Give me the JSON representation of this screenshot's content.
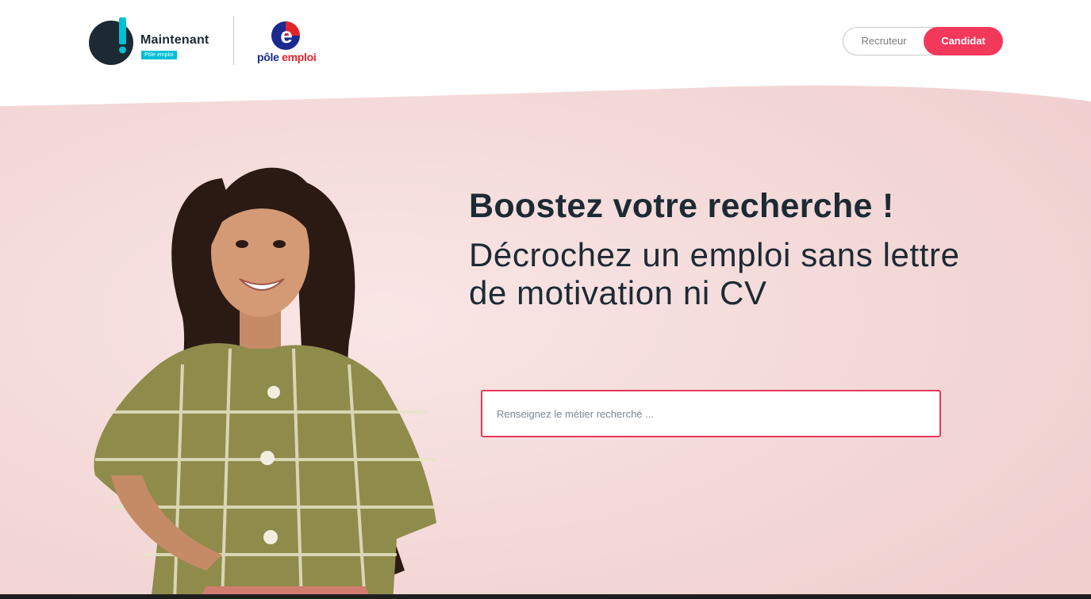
{
  "header": {
    "brand_name": "Maintenant",
    "brand_tag": "Pôle emploi",
    "partner_name_part1": "pôle ",
    "partner_name_part2": "emploi",
    "partner_mark": "e",
    "toggle": {
      "recruteur_label": "Recruteur",
      "candidat_label": "Candidat",
      "selected": "Candidat"
    }
  },
  "hero": {
    "headline": "Boostez votre recherche !",
    "subline": "Décrochez un emploi sans lettre de motivation ni CV",
    "search": {
      "placeholder": "Renseignez le métier recherché ...",
      "value": ""
    }
  },
  "colors": {
    "accent": "#f2385b",
    "brand_cyan": "#00bfd6",
    "dark": "#1d2a33",
    "hero_bg": "#f3d9d9"
  }
}
